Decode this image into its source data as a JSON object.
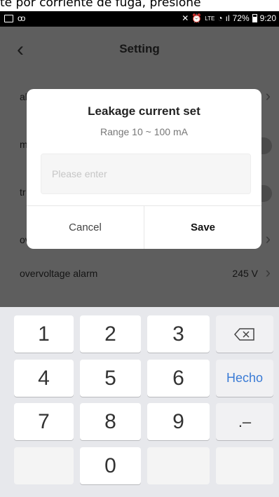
{
  "caption_text": "te por corriente de fuga, presione",
  "status_bar": {
    "battery": "72%",
    "time": "9:20",
    "lte_label": "LTE",
    "signal_text": "ıl"
  },
  "nav": {
    "back_icon": "chevron-left-icon",
    "title": "Setting"
  },
  "settings": {
    "rows": [
      {
        "label": "al",
        "control": "chevron"
      },
      {
        "label": "m",
        "control": "toggle"
      },
      {
        "label": "tr",
        "control": "toggle"
      },
      {
        "label": "ov",
        "control": "chevron"
      },
      {
        "label": "overvoltage alarm",
        "value": "245 V",
        "control": "chevron"
      }
    ]
  },
  "dialog": {
    "title": "Leakage current set",
    "subtitle": "Range 10 ~ 100 mA",
    "input_value": "",
    "input_placeholder": "Please enter",
    "cancel_label": "Cancel",
    "save_label": "Save"
  },
  "keyboard": {
    "keys": [
      "1",
      "2",
      "3",
      "4",
      "5",
      "6",
      "7",
      "8",
      "9",
      "0"
    ],
    "done_label": "Hecho",
    "symbol_label": ".–",
    "backspace_icon": "backspace-icon"
  },
  "colors": {
    "dim_overlay": "#5e5e5e",
    "done_accent": "#3a7bd5",
    "keyboard_bg": "#e7e8ec"
  }
}
